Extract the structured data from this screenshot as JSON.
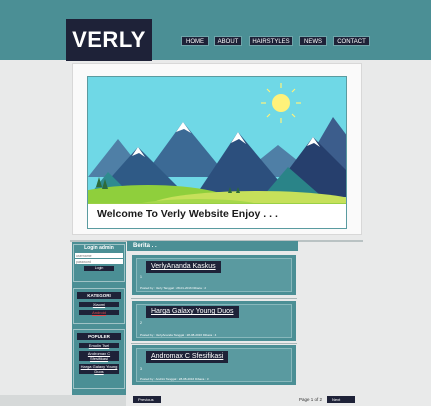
{
  "header": {
    "logo": "VERLY",
    "nav": [
      "HOME",
      "ABOUT",
      "HAIRSTYLES",
      "NEWS",
      "CONTACT"
    ]
  },
  "hero": {
    "caption": "Welcome To Verly Website Enjoy . . ."
  },
  "sidebar": {
    "login": {
      "title": "Login admin",
      "username_placeholder": "username",
      "password_placeholder": "password",
      "button": "Login"
    },
    "kategori": {
      "title": "KATEGORI",
      "items": [
        "Xiaomi",
        "Android"
      ]
    },
    "populer": {
      "title": "POPULER",
      "items": [
        "Emolin Tsel",
        "Andromax C Sfesifikasi",
        "Harga Galaxy Young Duos"
      ]
    }
  },
  "main": {
    "section_title": "Berita . .",
    "posts": [
      {
        "title": "VerlyAnanda Kaskus",
        "body": "1",
        "meta": "Posted by : Verly  Tanggal : 28-01-2016  Dibaca : 2"
      },
      {
        "title": "Harga Galaxy Young Duos",
        "body": "2",
        "meta": "Posted by : VerlyAnanda  Tanggal : 28-08-2016  Dibaca : 4"
      },
      {
        "title": "Andromax C Sfesifikasi",
        "body": "3",
        "meta": "Posted by : Andrini  Tanggal : 28-08-2016  Dibaca : 3"
      }
    ]
  },
  "pager": {
    "prev": "Previous",
    "info": "Page 1 of 2",
    "next": "Next"
  },
  "colors": {
    "teal": "#4b8f95",
    "navy": "#1e2238"
  }
}
